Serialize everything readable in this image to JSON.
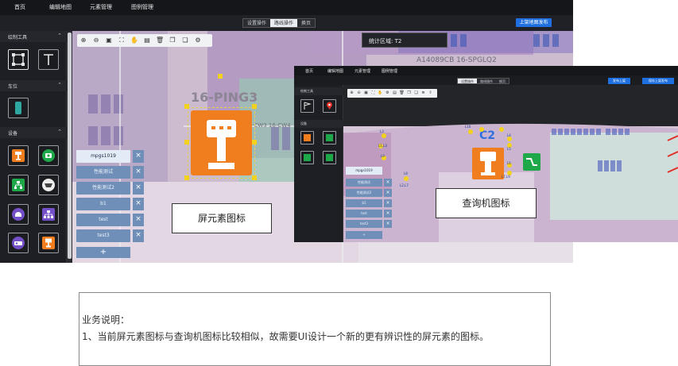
{
  "app": {
    "nav": [
      "首页",
      "编辑地图",
      "元素管理",
      "图例管理"
    ],
    "tabs": [
      "设置操作",
      "路线操作",
      "换页"
    ],
    "active_tab": 1,
    "primary_button": "上架地图发布",
    "sections": {
      "draw_tools": "绘制工具",
      "zone": "车位",
      "devices": "设备"
    },
    "stat_label": "统计区域: T2",
    "map_labels": [
      "16-PING3",
      "A14089CB 16-SPGLQ2",
      "16-CW3 16-CW4"
    ],
    "list_items": [
      "mpgs1019",
      "性能测试",
      "性能测试2",
      "b1",
      "test",
      "test3"
    ],
    "list_selected": 0,
    "list_add": "+",
    "list_remove": "×",
    "callout": "屏元素图标"
  },
  "app2": {
    "nav": [
      "首页",
      "编辑地图",
      "元素管理",
      "图例管理"
    ],
    "tabs": [
      "设置操作",
      "路线操作",
      "换页"
    ],
    "buttons": [
      "发布上架",
      "保存上架发布"
    ],
    "sections": [
      "绘制工具",
      "车位",
      "设备"
    ],
    "zone_label": "C2",
    "list_items": [
      "mpgs1019",
      "性能测试",
      "性能测试2",
      "b1",
      "test",
      "test3"
    ],
    "dot_labels": [
      "L3",
      "L1,L3",
      "L9",
      "L4",
      "L5",
      "L6",
      "L7,L9",
      "L8",
      "L2,L7",
      "L10"
    ],
    "callout": "查询机图标"
  },
  "note": {
    "title": "业务说明：",
    "line1": "1、当前屏元素图标与查询机图标比较相似，故需要UI设计一个新的更有辨识性的屏元素的图标。"
  },
  "colors": {
    "accent": "#1f6fe0",
    "device_orange": "#f07d1e",
    "device_green": "#1fa84a",
    "device_purple": "#7350c8",
    "list_blue": "#6f8fb9"
  }
}
